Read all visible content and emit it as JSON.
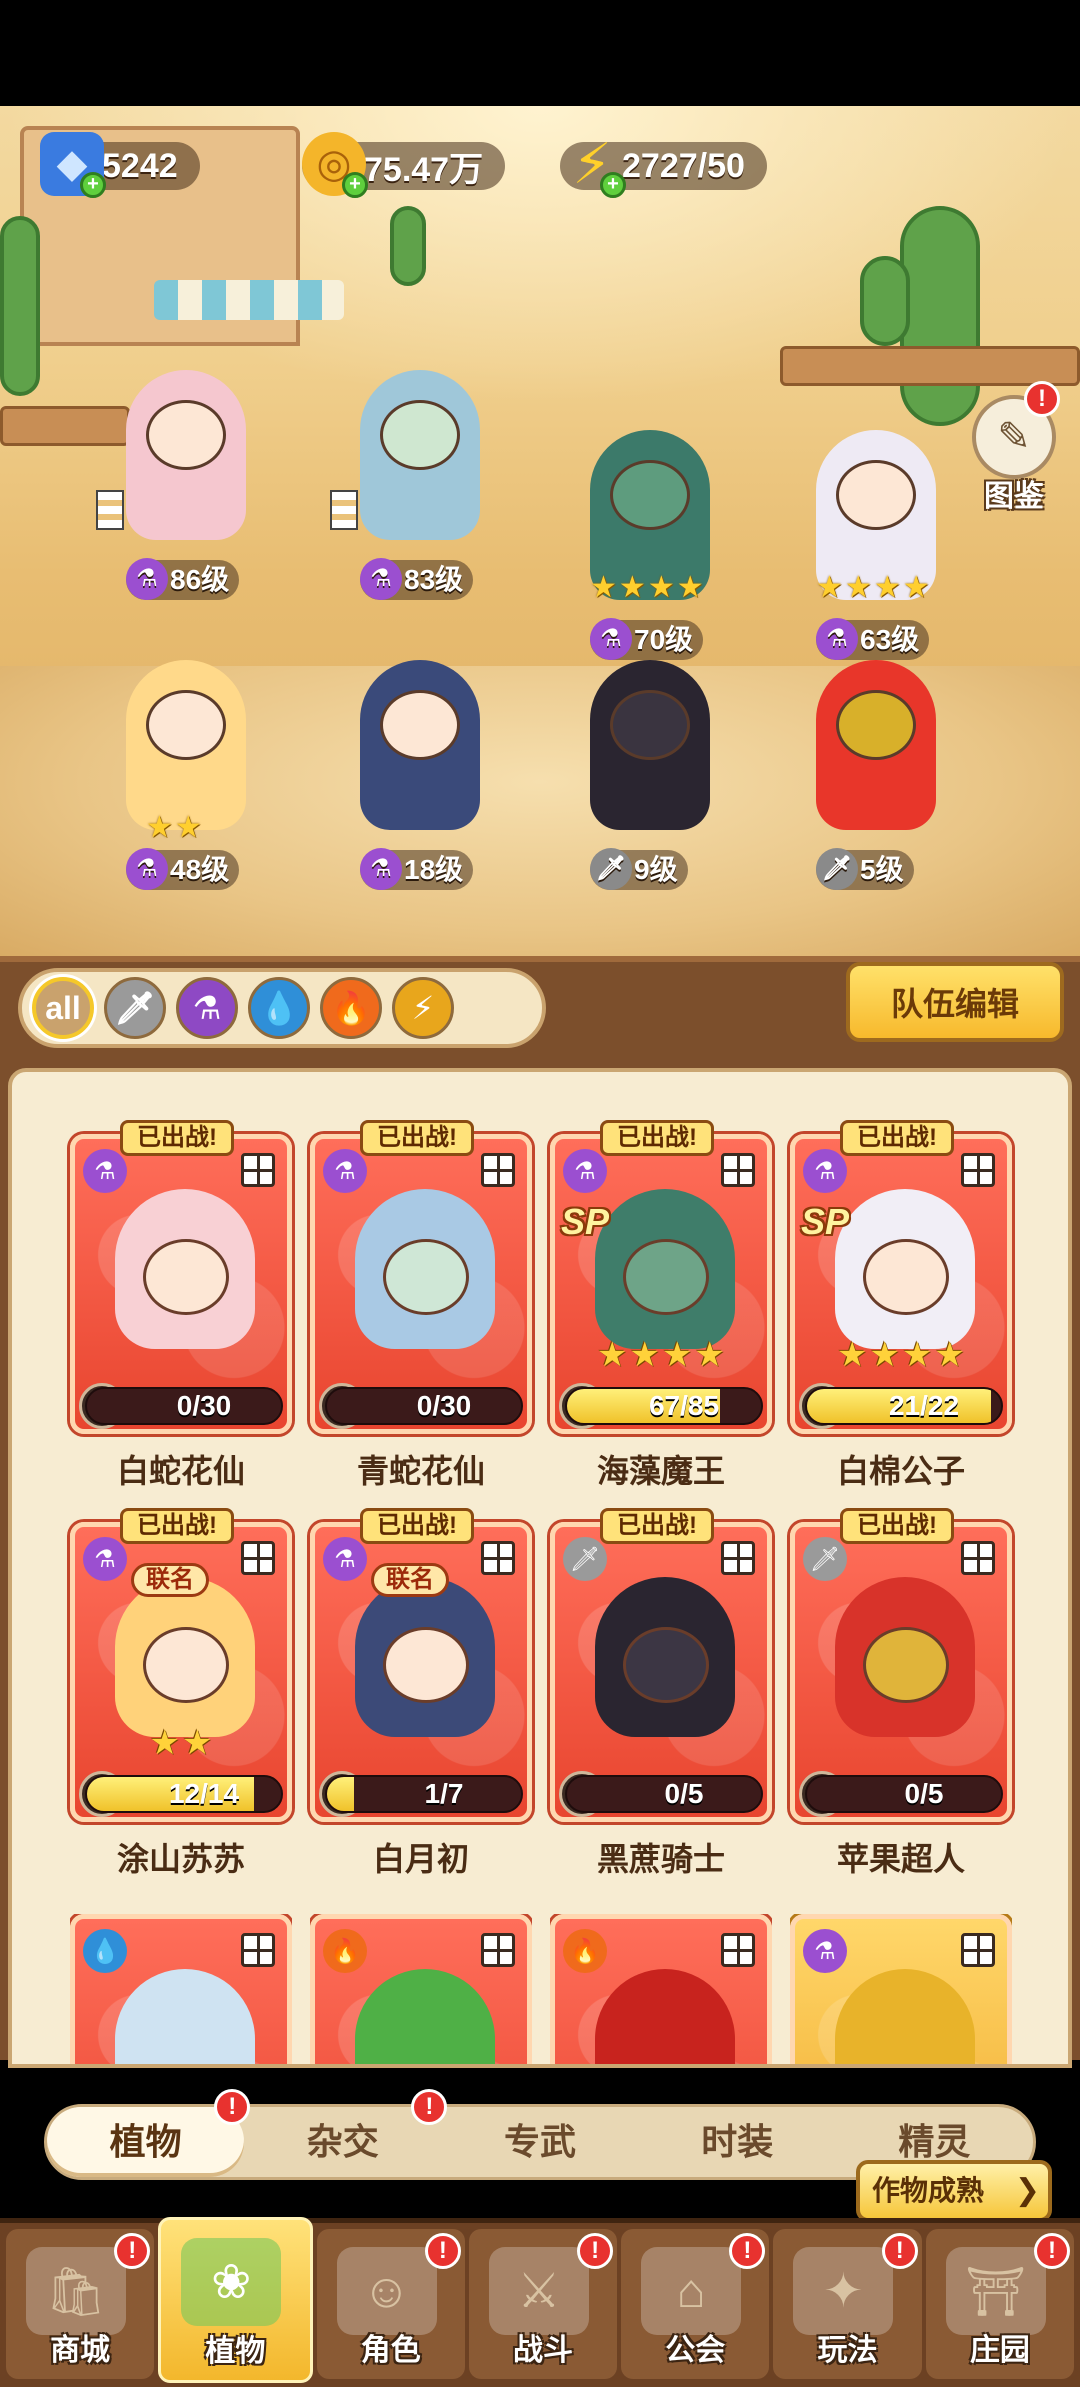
{
  "currency": {
    "diamonds": "5242",
    "gold": "75.47万",
    "energy": "2727/50"
  },
  "atlas": {
    "label": "图鉴",
    "has_alert": true
  },
  "field_units": [
    {
      "level": "86级",
      "type": "potion",
      "stars": 0
    },
    {
      "level": "83级",
      "type": "potion",
      "stars": 0
    },
    {
      "level": "70级",
      "type": "potion",
      "stars": 4
    },
    {
      "level": "63级",
      "type": "potion",
      "stars": 4
    },
    {
      "level": "48级",
      "type": "potion",
      "stars": 2
    },
    {
      "level": "18级",
      "type": "potion",
      "stars": 0
    },
    {
      "level": "9级",
      "type": "sword",
      "stars": 0
    },
    {
      "level": "5级",
      "type": "sword",
      "stars": 0
    }
  ],
  "filters": [
    "all",
    "sword",
    "potion",
    "water",
    "fire",
    "lightning"
  ],
  "team_edit_label": "队伍编辑",
  "deployed_label": "已出战!",
  "cards": [
    {
      "name": "白蛇花仙",
      "level": "86",
      "progress_text": "0/30",
      "progress": 0,
      "sp": false,
      "co_brand": "",
      "stars": 0,
      "type": "potion"
    },
    {
      "name": "青蛇花仙",
      "level": "83",
      "progress_text": "0/30",
      "progress": 0,
      "sp": false,
      "co_brand": "",
      "stars": 0,
      "type": "potion"
    },
    {
      "name": "海藻魔王",
      "level": "70",
      "progress_text": "67/85",
      "progress": 0.79,
      "sp": true,
      "co_brand": "",
      "stars": 4,
      "type": "potion"
    },
    {
      "name": "白棉公子",
      "level": "63",
      "progress_text": "21/22",
      "progress": 0.95,
      "sp": true,
      "co_brand": "",
      "stars": 4,
      "type": "potion"
    },
    {
      "name": "涂山苏苏",
      "level": "48",
      "progress_text": "12/14",
      "progress": 0.86,
      "sp": false,
      "co_brand": "联名",
      "stars": 2,
      "type": "potion"
    },
    {
      "name": "白月初",
      "level": "18",
      "progress_text": "1/7",
      "progress": 0.14,
      "sp": false,
      "co_brand": "联名",
      "stars": 0,
      "type": "potion"
    },
    {
      "name": "黑蔗骑士",
      "level": "9",
      "progress_text": "0/5",
      "progress": 0,
      "sp": false,
      "co_brand": "",
      "stars": 0,
      "type": "sword"
    },
    {
      "name": "苹果超人",
      "level": "5",
      "progress_text": "0/5",
      "progress": 0,
      "sp": false,
      "co_brand": "",
      "stars": 0,
      "type": "sword"
    }
  ],
  "tabs": [
    {
      "label": "植物",
      "alert": true
    },
    {
      "label": "杂交",
      "alert": true
    },
    {
      "label": "专武",
      "alert": false
    },
    {
      "label": "时装",
      "alert": false
    },
    {
      "label": "精灵",
      "alert": false
    }
  ],
  "crop_ripe_label": "作物成熟",
  "bottom_nav": [
    {
      "label": "商城",
      "alert": true
    },
    {
      "label": "植物",
      "alert": false
    },
    {
      "label": "角色",
      "alert": true
    },
    {
      "label": "战斗",
      "alert": true
    },
    {
      "label": "公会",
      "alert": true
    },
    {
      "label": "玩法",
      "alert": true
    },
    {
      "label": "庄园",
      "alert": true
    }
  ],
  "colors": {
    "card_red": "#e8452f",
    "panel_cream": "#f7ecd2",
    "frame_brown": "#7c4f2c",
    "accent_gold": "#f7b92c"
  }
}
